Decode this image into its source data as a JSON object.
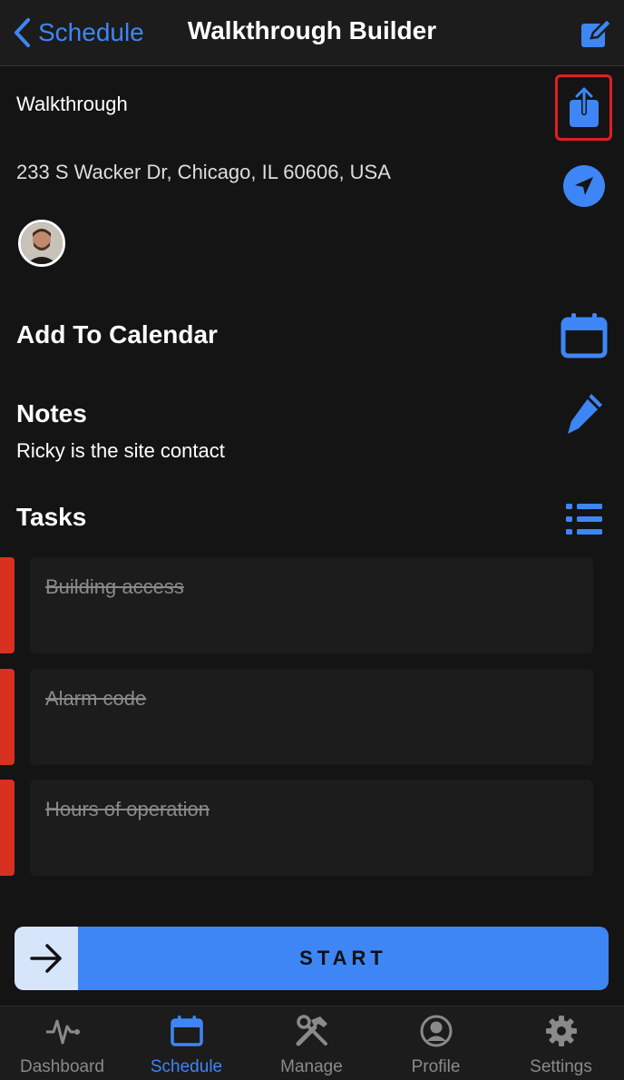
{
  "header": {
    "back_label": "Schedule",
    "title": "Walkthrough Builder"
  },
  "walkthrough": {
    "type_label": "Walkthrough",
    "address": "233 S Wacker Dr, Chicago, IL 60606, USA"
  },
  "calendar": {
    "title": "Add To Calendar"
  },
  "notes": {
    "title": "Notes",
    "text": "Ricky is the site contact"
  },
  "tasks": {
    "title": "Tasks",
    "items": [
      {
        "label": "Building access"
      },
      {
        "label": "Alarm code"
      },
      {
        "label": "Hours of operation"
      }
    ]
  },
  "start_button": {
    "label": "START"
  },
  "tabbar": {
    "items": [
      {
        "label": "Dashboard",
        "icon": "pulse-icon"
      },
      {
        "label": "Schedule",
        "icon": "calendar-icon"
      },
      {
        "label": "Manage",
        "icon": "tools-icon"
      },
      {
        "label": "Profile",
        "icon": "user-icon"
      },
      {
        "label": "Settings",
        "icon": "gear-icon"
      }
    ],
    "active": "Schedule"
  },
  "colors": {
    "accent": "#3e86f5",
    "task_marker": "#d9311f",
    "highlight_border": "#e11d24",
    "background": "#141414"
  }
}
